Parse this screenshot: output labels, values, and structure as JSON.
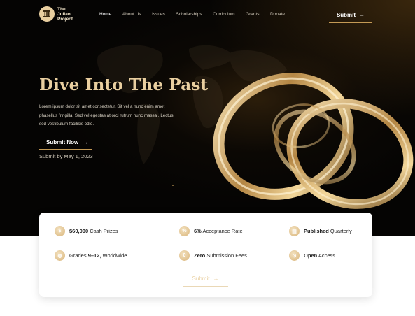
{
  "brand": {
    "name_line1": "The",
    "name_line2": "Julian",
    "name_line3": "Project"
  },
  "nav": {
    "items": [
      "Home",
      "About Us",
      "Issues",
      "Scholarships",
      "Curriculum",
      "Grants",
      "Donate"
    ],
    "submit_label": "Submit"
  },
  "hero": {
    "title": "Dive Into The Past",
    "blurb": "Lorem ipsum dolor sit amet consectetur. Sit vel a nunc enim amet phasellus fringilla. Sed vel egestas at orci rutrum nunc massa . Lectus sed vestibulum facilisis odio.",
    "submit_label": "Submit Now",
    "deadline": "Submit by May 1, 2023"
  },
  "stats": {
    "prizes": {
      "bold": "$60,000",
      "rest": " Cash Prizes",
      "icon": "dollar-icon"
    },
    "acceptance": {
      "bold": "6%",
      "rest": " Acceptance Rate",
      "icon": "percent-icon"
    },
    "published": {
      "bold": "Published",
      "rest": " Quarterly",
      "icon": "calendar-icon"
    },
    "grades": {
      "pre": "Grades ",
      "bold": "9–12,",
      "rest": " Worldwide",
      "icon": "globe-icon"
    },
    "fees": {
      "bold": "Zero",
      "rest": " Submission Fees",
      "icon": "zero-fee-icon"
    },
    "access": {
      "bold": "Open",
      "rest": " Access",
      "icon": "unlock-icon"
    },
    "submit_label": "Submit"
  },
  "colors": {
    "gold": "#e9cfa0",
    "accent": "#c49a55",
    "dark": "#050403"
  }
}
